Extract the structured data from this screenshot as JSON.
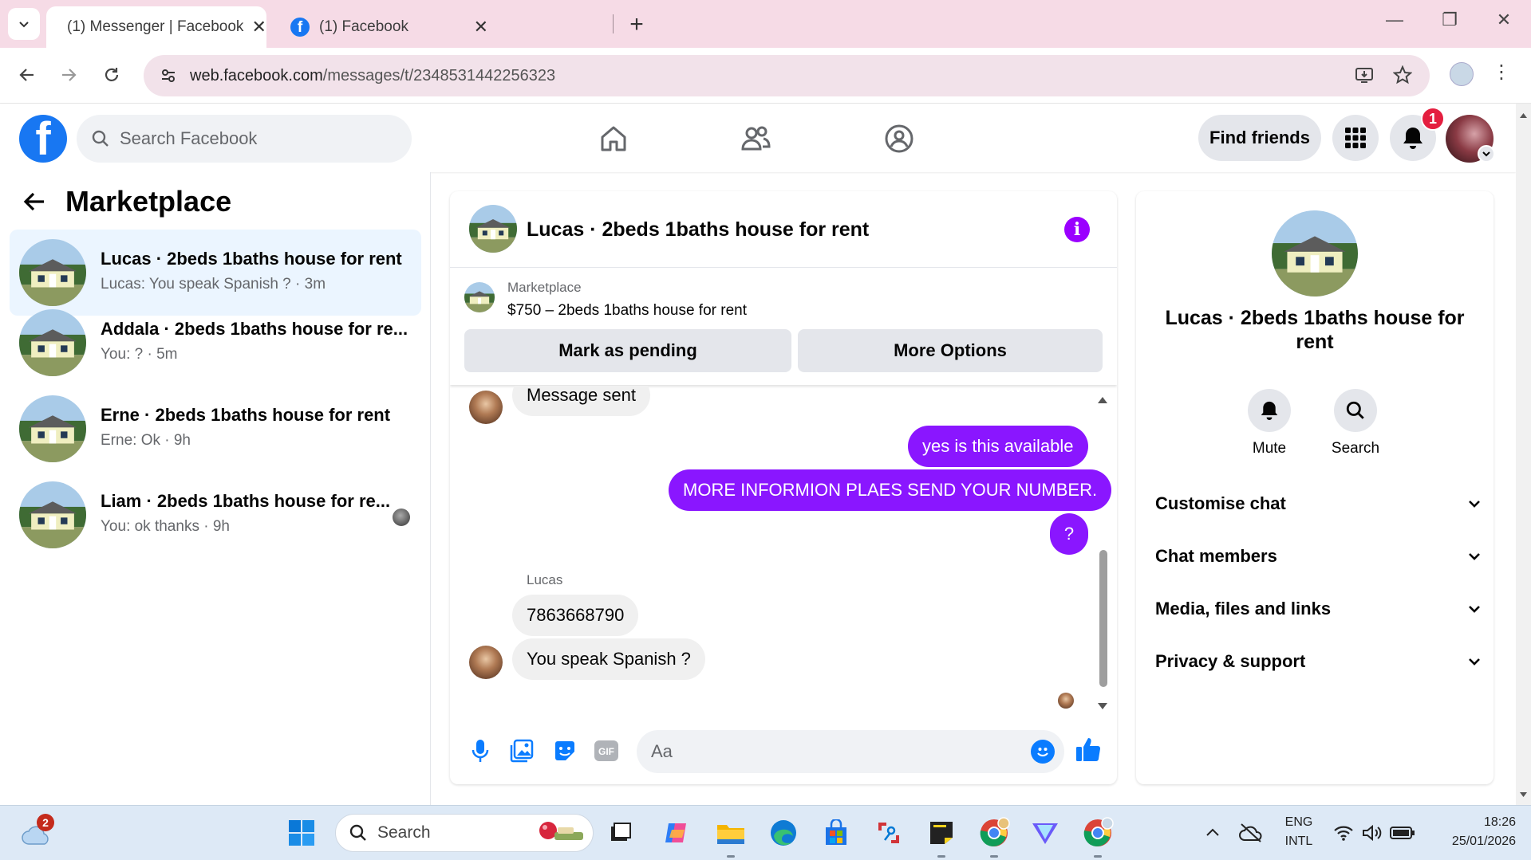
{
  "browser": {
    "tabs": [
      {
        "title": "(1) Messenger | Facebook",
        "active": true
      },
      {
        "title": "(1) Facebook",
        "active": false
      }
    ],
    "url_host": "web.facebook.com",
    "url_path": "/messages/t/2348531442256323"
  },
  "header": {
    "search_placeholder": "Search Facebook",
    "find_friends_label": "Find friends",
    "notification_count": "1"
  },
  "sidebar": {
    "title": "Marketplace",
    "conversations": [
      {
        "name": "Lucas · 2beds 1baths house for rent",
        "preview": "Lucas: You speak Spanish ? · 3m",
        "selected": true
      },
      {
        "name": "Addala · 2beds 1baths house for re...",
        "preview": "You: ? · 5m",
        "selected": false
      },
      {
        "name": "Erne · 2beds 1baths house for rent",
        "preview": "Erne: Ok · 9h",
        "selected": false
      },
      {
        "name": "Liam · 2beds 1baths house for re...",
        "preview": "You: ok thanks · 9h",
        "selected": false
      }
    ]
  },
  "chat": {
    "title": "Lucas · 2beds 1baths house for rent",
    "marketplace_label": "Marketplace",
    "listing": "$750 – 2beds 1baths house for rent",
    "mark_pending_label": "Mark as pending",
    "more_options_label": "More Options",
    "messages": [
      {
        "from": "them",
        "text": "Message sent"
      },
      {
        "from": "me",
        "text": "yes is this available"
      },
      {
        "from": "me",
        "text": "MORE INFORMION PLAES SEND YOUR NUMBER."
      },
      {
        "from": "me",
        "text": "?"
      },
      {
        "from": "them",
        "sender": "Lucas",
        "text": "7863668790"
      },
      {
        "from": "them",
        "text": "You speak Spanish ?"
      }
    ],
    "sender_name": "Lucas",
    "composer_placeholder": "Aa"
  },
  "info_panel": {
    "title": "Lucas · 2beds 1baths house for rent",
    "actions": [
      {
        "label": "Mute",
        "icon": "bell-icon"
      },
      {
        "label": "Search",
        "icon": "search-icon"
      }
    ],
    "sections": [
      "Customise chat",
      "Chat members",
      "Media, files and links",
      "Privacy & support"
    ]
  },
  "taskbar": {
    "search_label": "Search",
    "weather_badge": "2",
    "language": "ENG",
    "layout": "INTL",
    "time": "18:26",
    "date": "25/01/2026"
  },
  "colors": {
    "facebook_blue": "#1877f2",
    "messenger_purple": "#8a16ff",
    "selected_row": "#ebf5ff",
    "tab_strip": "#f6dbe6"
  }
}
